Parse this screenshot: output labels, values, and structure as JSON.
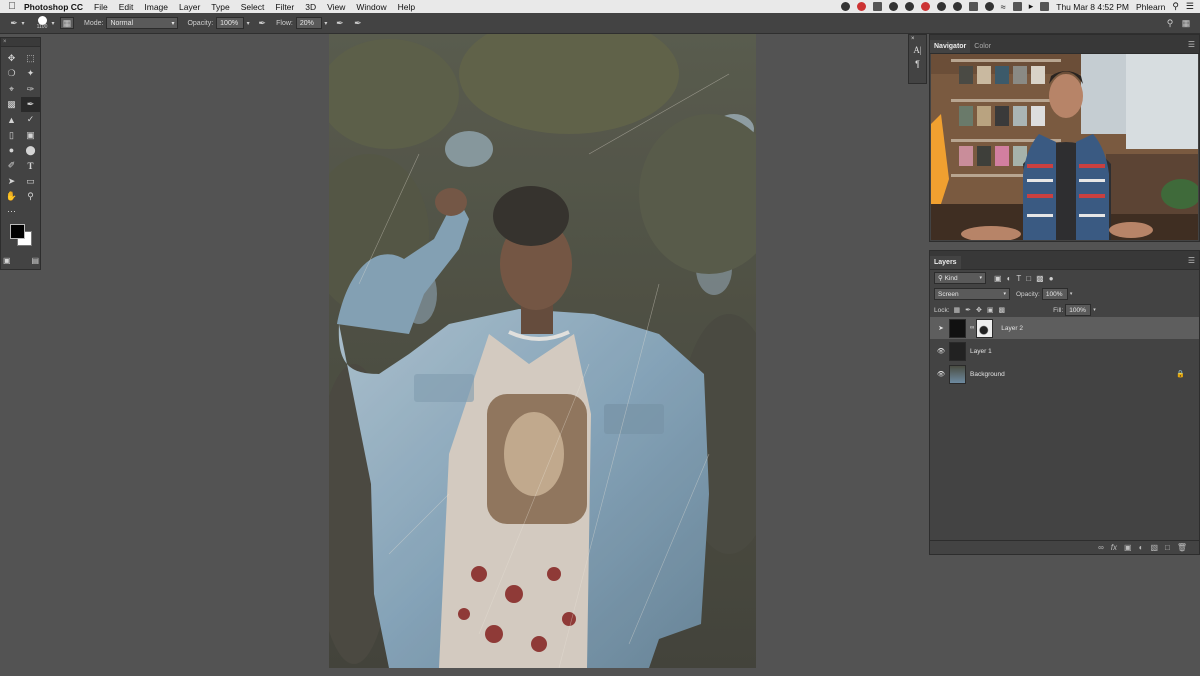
{
  "menubar": {
    "app_name": "Photoshop CC",
    "items": [
      "File",
      "Edit",
      "Image",
      "Layer",
      "Type",
      "Select",
      "Filter",
      "3D",
      "View",
      "Window",
      "Help"
    ],
    "clock": "Thu Mar 8  4:52 PM",
    "user": "Phlearn"
  },
  "options": {
    "brush_size": "1100",
    "mode_label": "Mode:",
    "mode_value": "Normal",
    "opacity_label": "Opacity:",
    "opacity_value": "100%",
    "flow_label": "Flow:",
    "flow_value": "20%"
  },
  "navigator": {
    "tabs": [
      "Navigator",
      "Color"
    ]
  },
  "layers_panel": {
    "title": "Layers",
    "filter_kind": "Kind",
    "blend_mode": "Screen",
    "opacity_label": "Opacity:",
    "opacity_value": "100%",
    "lock_label": "Lock:",
    "fill_label": "Fill:",
    "fill_value": "100%",
    "layers": [
      {
        "name": "Layer 2"
      },
      {
        "name": "Layer 1"
      },
      {
        "name": "Background"
      }
    ]
  },
  "colors": {
    "panel_bg": "#434343",
    "workspace_bg": "#535353",
    "selected_layer": "#5e5e5e"
  }
}
